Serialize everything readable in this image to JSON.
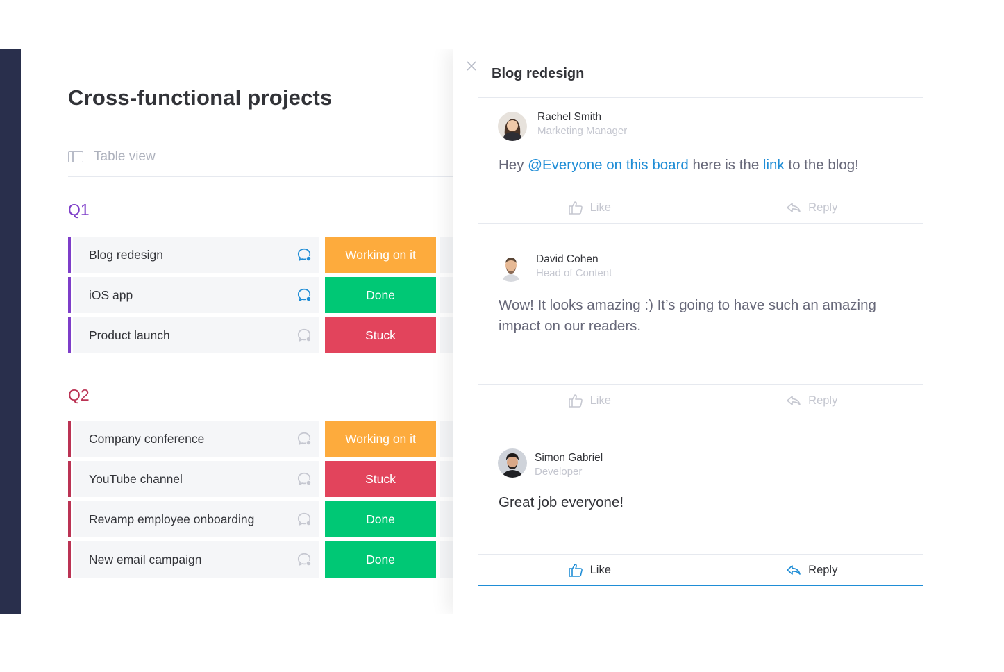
{
  "board": {
    "title": "Cross-functional projects",
    "view_tab": "Table view"
  },
  "groups": [
    {
      "title": "Q1",
      "color": "#7e3ec9",
      "items": [
        {
          "name": "Blog redesign",
          "status": "Working on it",
          "status_color": "#fdab3d",
          "has_updates": true
        },
        {
          "name": "iOS app",
          "status": "Done",
          "status_color": "#00c875",
          "has_updates": true
        },
        {
          "name": "Product launch",
          "status": "Stuck",
          "status_color": "#e2445c",
          "has_updates": false
        }
      ]
    },
    {
      "title": "Q2",
      "color": "#bb3354",
      "items": [
        {
          "name": "Company conference",
          "status": "Working on it",
          "status_color": "#fdab3d",
          "has_updates": false
        },
        {
          "name": "YouTube channel",
          "status": "Stuck",
          "status_color": "#e2445c",
          "has_updates": false
        },
        {
          "name": "Revamp employee onboarding",
          "status": "Done",
          "status_color": "#00c875",
          "has_updates": false
        },
        {
          "name": "New email campaign",
          "status": "Done",
          "status_color": "#00c875",
          "has_updates": false
        }
      ]
    }
  ],
  "panel": {
    "title": "Blog redesign",
    "updates": [
      {
        "author": "Rachel Smith",
        "role": "Marketing Manager",
        "body_parts": [
          "Hey ",
          "@Everyone on this board",
          " here is the ",
          "link",
          " to the blog!"
        ],
        "like_label": "Like",
        "reply_label": "Reply"
      },
      {
        "author": "David Cohen",
        "role": "Head of Content",
        "body": "Wow! It looks amazing :) It’s going to have such an amazing impact on our readers.",
        "like_label": "Like",
        "reply_label": "Reply"
      },
      {
        "author": "Simon Gabriel",
        "role": "Developer",
        "body": "Great job everyone!",
        "like_label": "Like",
        "reply_label": "Reply"
      }
    ]
  },
  "colors": {
    "accent": "#1f8dd6",
    "left_rail": "#292f4c"
  }
}
